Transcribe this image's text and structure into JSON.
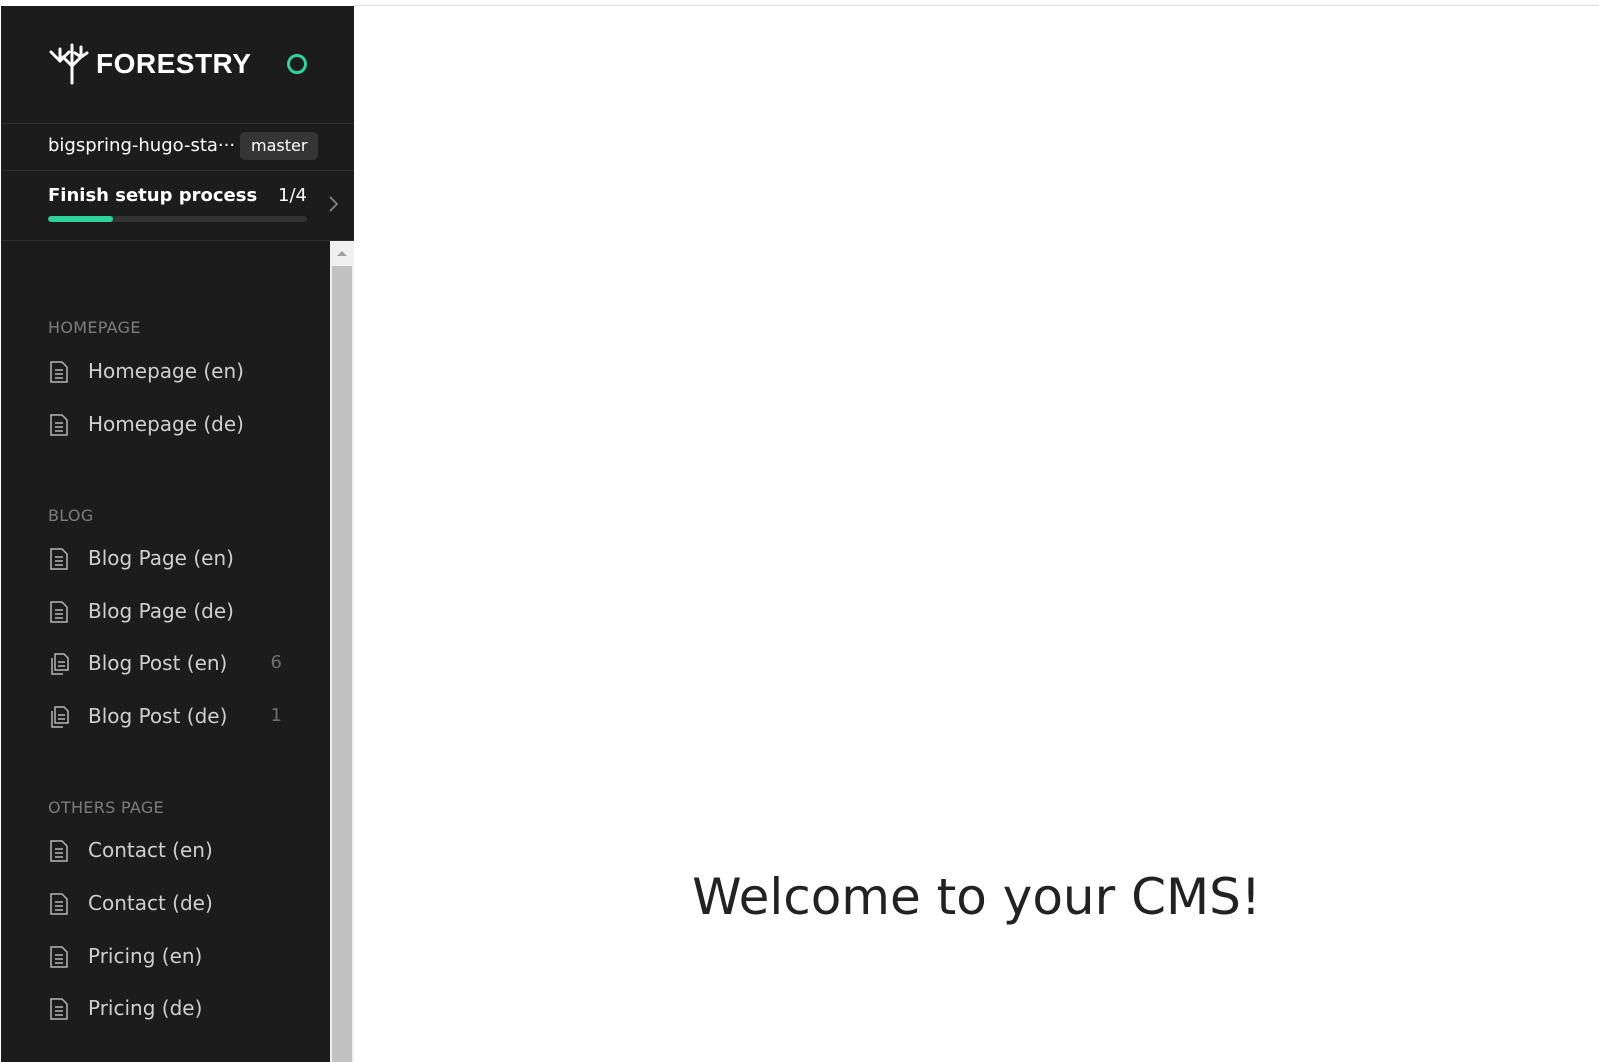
{
  "brand": {
    "name": "FORESTRY",
    "status_color": "#2ed39b"
  },
  "repo": {
    "name": "bigspring-hugo-sta···",
    "branch": "master"
  },
  "setup": {
    "title": "Finish setup process",
    "progress_text": "1/4",
    "progress_fraction": 0.25
  },
  "sections": [
    {
      "label": "HOMEPAGE",
      "items": [
        {
          "label": "Homepage (en)",
          "icon": "document-icon"
        },
        {
          "label": "Homepage (de)",
          "icon": "document-icon"
        }
      ]
    },
    {
      "label": "BLOG",
      "items": [
        {
          "label": "Blog Page (en)",
          "icon": "document-icon"
        },
        {
          "label": "Blog Page (de)",
          "icon": "document-icon"
        },
        {
          "label": "Blog Post (en)",
          "icon": "documents-icon",
          "count": "6"
        },
        {
          "label": "Blog Post (de)",
          "icon": "documents-icon",
          "count": "1"
        }
      ]
    },
    {
      "label": "OTHERS PAGE",
      "items": [
        {
          "label": "Contact (en)",
          "icon": "document-icon"
        },
        {
          "label": "Contact (de)",
          "icon": "document-icon"
        },
        {
          "label": "Pricing (en)",
          "icon": "document-icon"
        },
        {
          "label": "Pricing (de)",
          "icon": "document-icon"
        }
      ]
    }
  ],
  "main": {
    "welcome": "Welcome to your CMS!"
  },
  "colors": {
    "sidebar_bg": "#1c1c1c",
    "accent": "#2ed39b"
  }
}
